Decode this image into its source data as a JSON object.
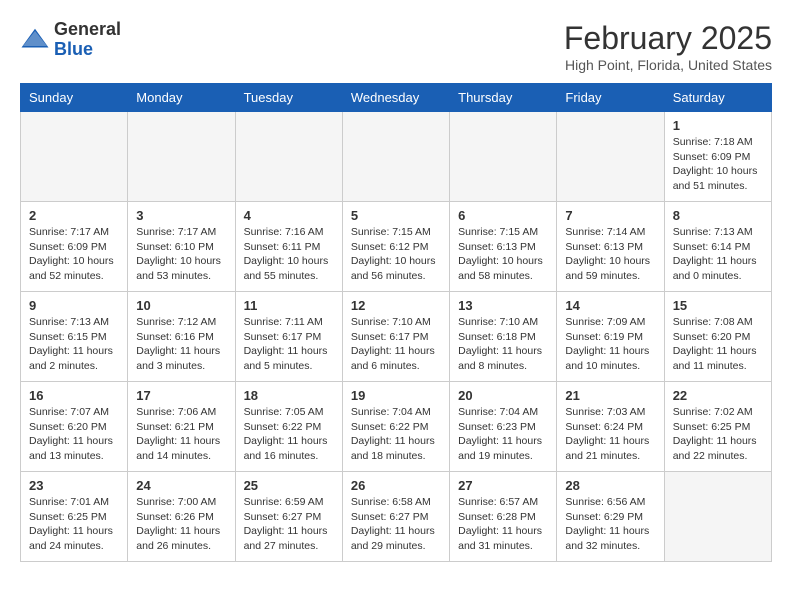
{
  "header": {
    "logo": {
      "line1": "General",
      "line2": "Blue"
    },
    "title": "February 2025",
    "location": "High Point, Florida, United States"
  },
  "weekdays": [
    "Sunday",
    "Monday",
    "Tuesday",
    "Wednesday",
    "Thursday",
    "Friday",
    "Saturday"
  ],
  "weeks": [
    [
      {
        "day": null,
        "info": ""
      },
      {
        "day": null,
        "info": ""
      },
      {
        "day": null,
        "info": ""
      },
      {
        "day": null,
        "info": ""
      },
      {
        "day": null,
        "info": ""
      },
      {
        "day": null,
        "info": ""
      },
      {
        "day": 1,
        "info": "Sunrise: 7:18 AM\nSunset: 6:09 PM\nDaylight: 10 hours and 51 minutes."
      }
    ],
    [
      {
        "day": 2,
        "info": "Sunrise: 7:17 AM\nSunset: 6:09 PM\nDaylight: 10 hours and 52 minutes."
      },
      {
        "day": 3,
        "info": "Sunrise: 7:17 AM\nSunset: 6:10 PM\nDaylight: 10 hours and 53 minutes."
      },
      {
        "day": 4,
        "info": "Sunrise: 7:16 AM\nSunset: 6:11 PM\nDaylight: 10 hours and 55 minutes."
      },
      {
        "day": 5,
        "info": "Sunrise: 7:15 AM\nSunset: 6:12 PM\nDaylight: 10 hours and 56 minutes."
      },
      {
        "day": 6,
        "info": "Sunrise: 7:15 AM\nSunset: 6:13 PM\nDaylight: 10 hours and 58 minutes."
      },
      {
        "day": 7,
        "info": "Sunrise: 7:14 AM\nSunset: 6:13 PM\nDaylight: 10 hours and 59 minutes."
      },
      {
        "day": 8,
        "info": "Sunrise: 7:13 AM\nSunset: 6:14 PM\nDaylight: 11 hours and 0 minutes."
      }
    ],
    [
      {
        "day": 9,
        "info": "Sunrise: 7:13 AM\nSunset: 6:15 PM\nDaylight: 11 hours and 2 minutes."
      },
      {
        "day": 10,
        "info": "Sunrise: 7:12 AM\nSunset: 6:16 PM\nDaylight: 11 hours and 3 minutes."
      },
      {
        "day": 11,
        "info": "Sunrise: 7:11 AM\nSunset: 6:17 PM\nDaylight: 11 hours and 5 minutes."
      },
      {
        "day": 12,
        "info": "Sunrise: 7:10 AM\nSunset: 6:17 PM\nDaylight: 11 hours and 6 minutes."
      },
      {
        "day": 13,
        "info": "Sunrise: 7:10 AM\nSunset: 6:18 PM\nDaylight: 11 hours and 8 minutes."
      },
      {
        "day": 14,
        "info": "Sunrise: 7:09 AM\nSunset: 6:19 PM\nDaylight: 11 hours and 10 minutes."
      },
      {
        "day": 15,
        "info": "Sunrise: 7:08 AM\nSunset: 6:20 PM\nDaylight: 11 hours and 11 minutes."
      }
    ],
    [
      {
        "day": 16,
        "info": "Sunrise: 7:07 AM\nSunset: 6:20 PM\nDaylight: 11 hours and 13 minutes."
      },
      {
        "day": 17,
        "info": "Sunrise: 7:06 AM\nSunset: 6:21 PM\nDaylight: 11 hours and 14 minutes."
      },
      {
        "day": 18,
        "info": "Sunrise: 7:05 AM\nSunset: 6:22 PM\nDaylight: 11 hours and 16 minutes."
      },
      {
        "day": 19,
        "info": "Sunrise: 7:04 AM\nSunset: 6:22 PM\nDaylight: 11 hours and 18 minutes."
      },
      {
        "day": 20,
        "info": "Sunrise: 7:04 AM\nSunset: 6:23 PM\nDaylight: 11 hours and 19 minutes."
      },
      {
        "day": 21,
        "info": "Sunrise: 7:03 AM\nSunset: 6:24 PM\nDaylight: 11 hours and 21 minutes."
      },
      {
        "day": 22,
        "info": "Sunrise: 7:02 AM\nSunset: 6:25 PM\nDaylight: 11 hours and 22 minutes."
      }
    ],
    [
      {
        "day": 23,
        "info": "Sunrise: 7:01 AM\nSunset: 6:25 PM\nDaylight: 11 hours and 24 minutes."
      },
      {
        "day": 24,
        "info": "Sunrise: 7:00 AM\nSunset: 6:26 PM\nDaylight: 11 hours and 26 minutes."
      },
      {
        "day": 25,
        "info": "Sunrise: 6:59 AM\nSunset: 6:27 PM\nDaylight: 11 hours and 27 minutes."
      },
      {
        "day": 26,
        "info": "Sunrise: 6:58 AM\nSunset: 6:27 PM\nDaylight: 11 hours and 29 minutes."
      },
      {
        "day": 27,
        "info": "Sunrise: 6:57 AM\nSunset: 6:28 PM\nDaylight: 11 hours and 31 minutes."
      },
      {
        "day": 28,
        "info": "Sunrise: 6:56 AM\nSunset: 6:29 PM\nDaylight: 11 hours and 32 minutes."
      },
      {
        "day": null,
        "info": ""
      }
    ]
  ]
}
